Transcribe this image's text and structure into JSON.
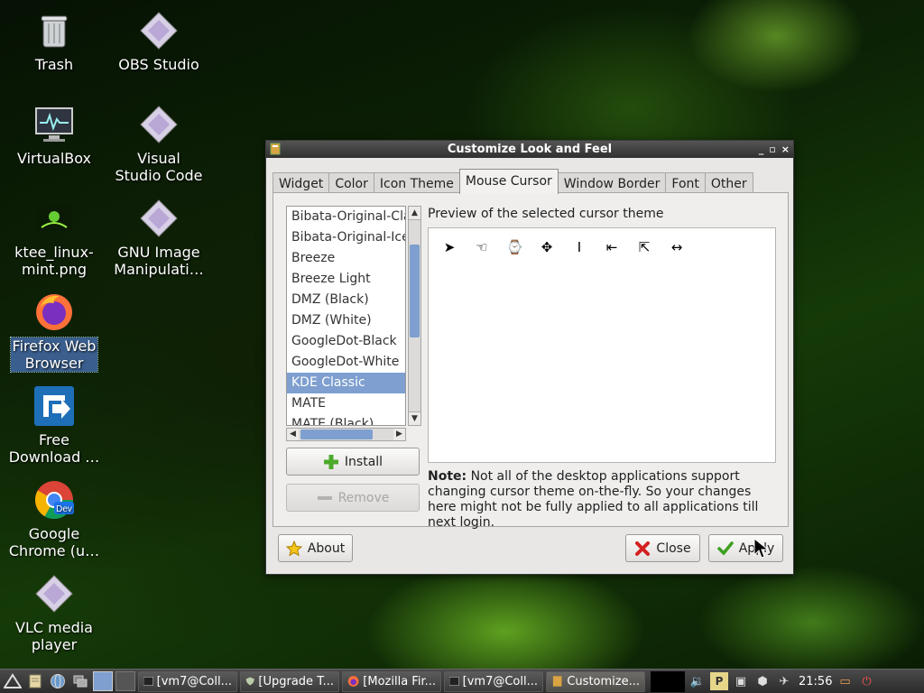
{
  "desktop": {
    "icons": [
      {
        "label": "Trash"
      },
      {
        "label": "OBS Studio"
      },
      {
        "label": "VirtualBox"
      },
      {
        "label": "Visual\nStudio Code"
      },
      {
        "label": "ktee_linux-\nmint.png"
      },
      {
        "label": "GNU Image\nManipulati…"
      },
      {
        "label": "Firefox Web\nBrowser"
      },
      {
        "label": "Free\nDownload …"
      },
      {
        "label": "Google\nChrome (u…"
      },
      {
        "label": "VLC media\nplayer"
      }
    ]
  },
  "window": {
    "title": "Customize Look and Feel",
    "controls": [
      "_",
      "▫",
      "×"
    ],
    "tabs": [
      "Widget",
      "Color",
      "Icon Theme",
      "Mouse Cursor",
      "Window Border",
      "Font",
      "Other"
    ],
    "active_tab": "Mouse Cursor",
    "cursor_themes": [
      "Bibata-Original-Cla",
      "Bibata-Original-Ice",
      "Breeze",
      "Breeze Light",
      "DMZ (Black)",
      "DMZ (White)",
      "GoogleDot-Black",
      "GoogleDot-White",
      "KDE Classic",
      "MATE",
      "MATE (Black)"
    ],
    "selected_theme": "KDE Classic",
    "install_label": "Install",
    "remove_label": "Remove",
    "preview_label": "Preview of the selected cursor theme",
    "preview_cursors": [
      "arrow",
      "hand",
      "watch",
      "move",
      "text",
      "left-edge",
      "top-left-corner",
      "horizontal-resize"
    ],
    "note_bold": "Note:",
    "note_text": " Not all of the desktop applications support changing cursor theme on-the-fly. So your changes here might not be fully applied to all applications till next login.",
    "about_label": "About",
    "close_label": "Close",
    "apply_label": "Apply"
  },
  "taskbar": {
    "tasks": [
      "[vm7@Coll...",
      "[Upgrade T...",
      "[Mozilla Fir...",
      "[vm7@Coll...",
      "Customize..."
    ],
    "active_task": "Customize...",
    "clock": "21:56"
  }
}
